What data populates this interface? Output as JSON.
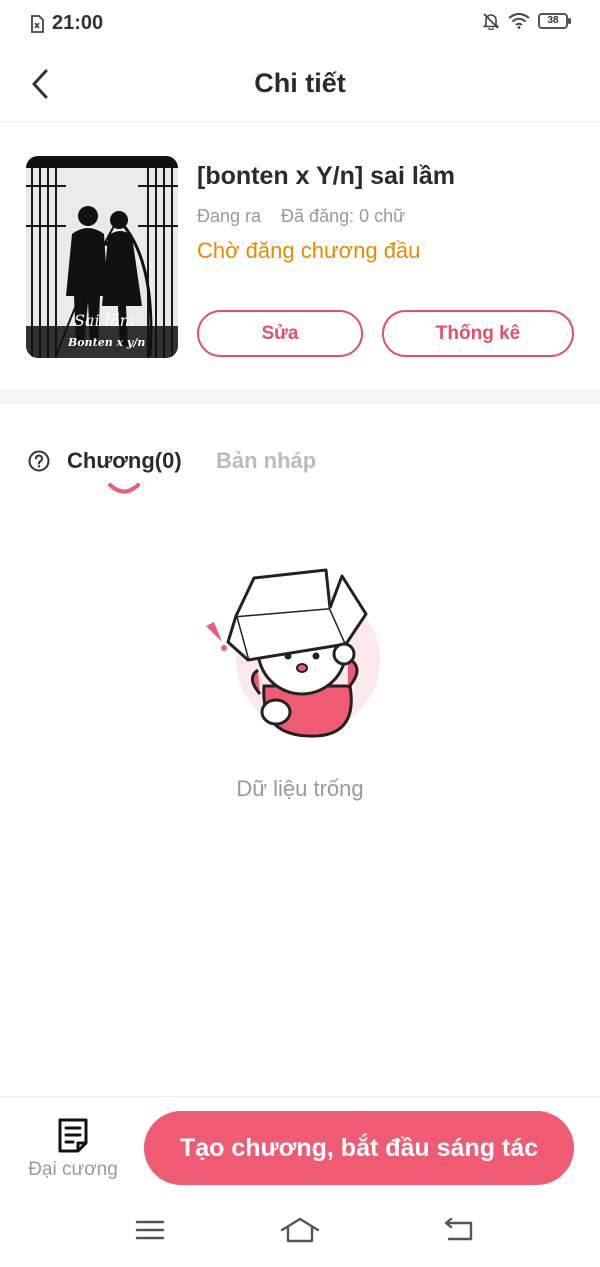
{
  "status_bar": {
    "time": "21:00",
    "battery": "38",
    "icons": [
      "sim-card-icon",
      "bell-off-icon",
      "wifi-icon",
      "battery-icon"
    ]
  },
  "header": {
    "title": "Chi tiết",
    "back_icon": "chevron-left-icon"
  },
  "book": {
    "title": "[bonten x Y/n] sai lầm",
    "status": "Đang ra",
    "published": "Đã đăng: 0 chữ",
    "pending_text": "Chờ đăng chương đầu",
    "cover_text": "Sai lầm",
    "cover_subtext": "Bonten x y/n",
    "edit_label": "Sửa",
    "stats_label": "Thống kê"
  },
  "tabs": {
    "chapters_label": "Chương(0)",
    "drafts_label": "Bản nháp",
    "help_icon": "question-circle-icon"
  },
  "empty": {
    "text": "Dữ liệu trống"
  },
  "bottom": {
    "outline_label": "Đại cương",
    "create_label": "Tạo chương, bắt đầu sáng tác"
  },
  "colors": {
    "accent": "#ef5b73",
    "pending": "#e68a00",
    "muted": "#9a9a9a"
  }
}
